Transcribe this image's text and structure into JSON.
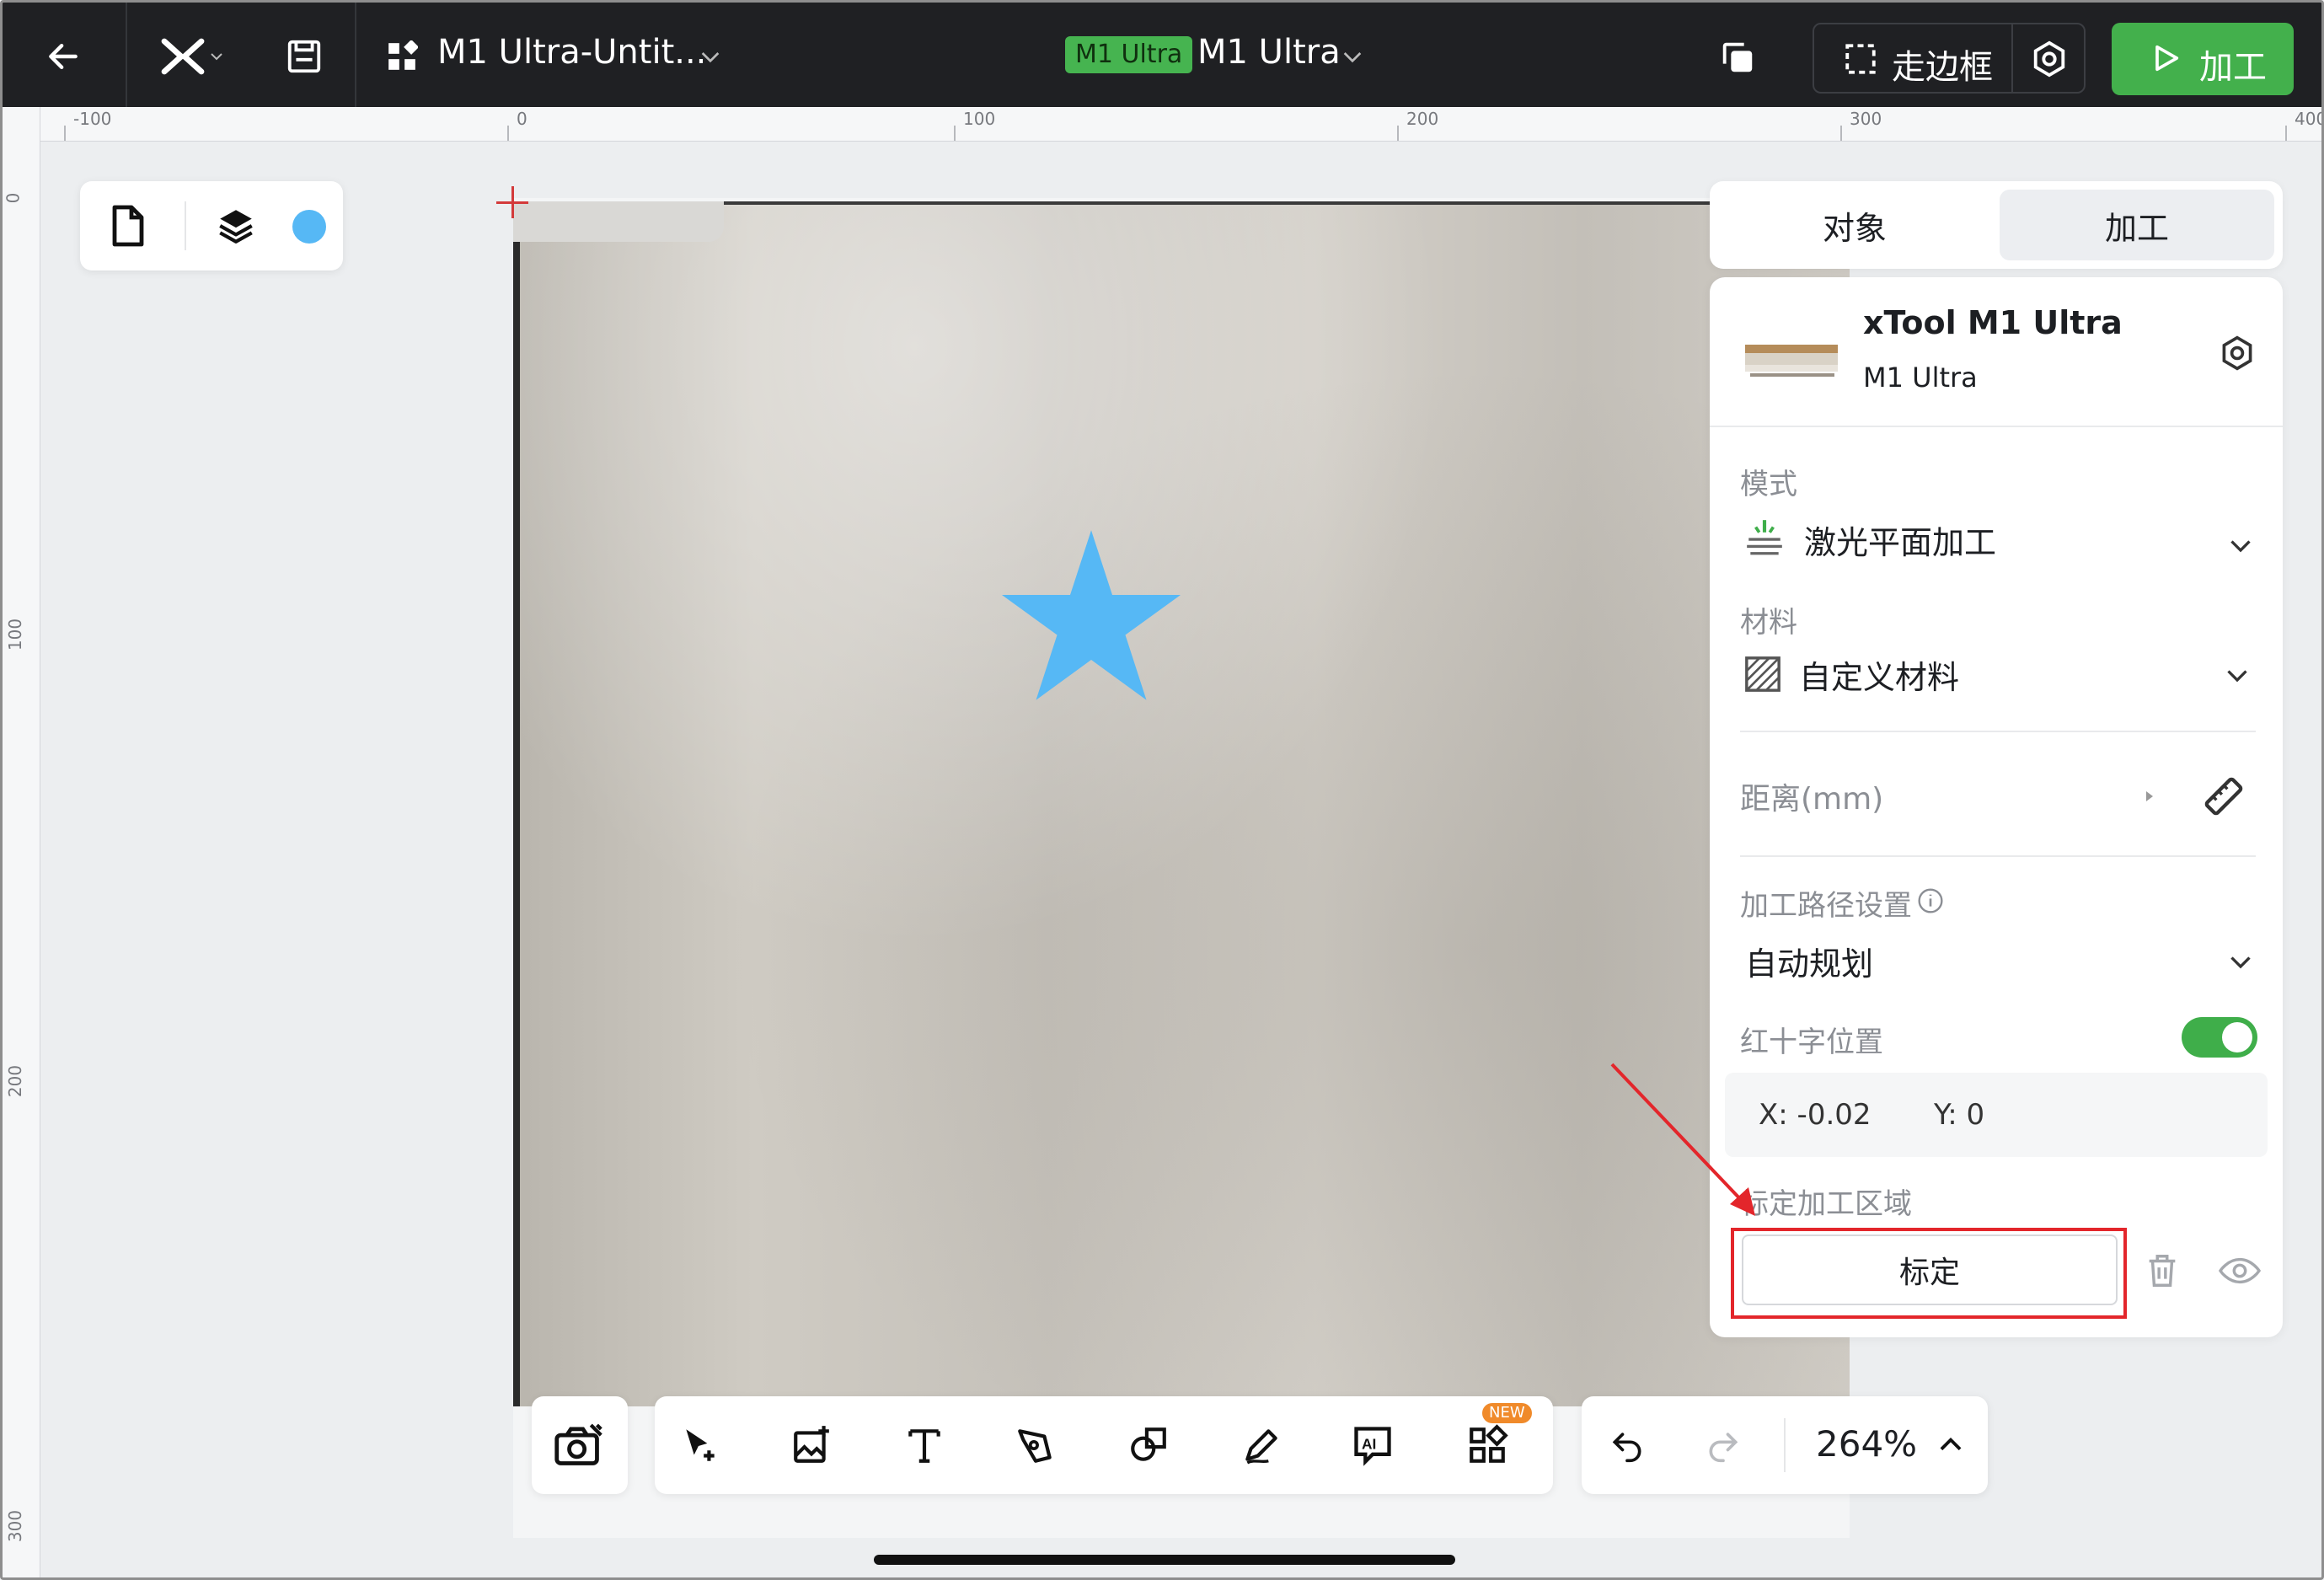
{
  "topbar": {
    "doc_title": "M1 Ultra-Untit...",
    "badge": "M1 Ultra",
    "model_name": "M1 Ultra",
    "frame_label": "走边框",
    "process_label": "加工"
  },
  "rulers": {
    "h_labels": [
      "-100",
      "0",
      "100",
      "200",
      "300",
      "400"
    ],
    "v_labels": [
      "0",
      "100",
      "200",
      "300"
    ]
  },
  "canvas": {
    "shape": "star",
    "shape_color": "#56b8f5"
  },
  "panel": {
    "tab_object": "对象",
    "tab_process": "加工",
    "device_name": "xTool M1 Ultra",
    "device_model": "M1 Ultra",
    "mode_label": "模式",
    "mode_value": "激光平面加工",
    "material_label": "材料",
    "material_value": "自定义材料",
    "distance_label": "距离(mm)",
    "path_label": "加工路径设置",
    "path_value": "自动规划",
    "cross_label": "红十字位置",
    "cross_enabled": true,
    "coord_x": "X: -0.02",
    "coord_y": "Y: 0",
    "calib_area_label": "标定加工区域",
    "calib_button": "标定"
  },
  "bottom": {
    "new_tag": "NEW",
    "zoom": "264%"
  },
  "colors": {
    "accent_green": "#43b04c",
    "annotation_red": "#e3262b",
    "topbar_bg": "#1f2023"
  }
}
